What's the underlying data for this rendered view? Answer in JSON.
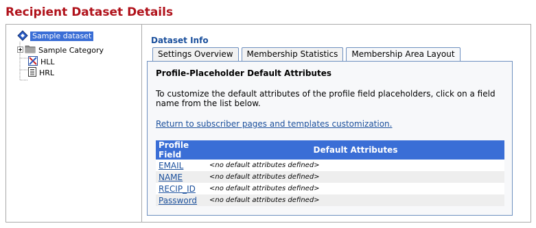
{
  "page": {
    "title": "Recipient Dataset Details"
  },
  "tree": {
    "root": {
      "label": "Sample dataset",
      "icon": "dataset-icon",
      "selected": true
    },
    "items": [
      {
        "label": "Sample Category",
        "icon": "folder-icon",
        "expander": "+"
      },
      {
        "label": "HLL",
        "icon": "hll-icon"
      },
      {
        "label": "HRL",
        "icon": "hrl-icon"
      }
    ]
  },
  "section": {
    "title": "Dataset Info"
  },
  "tabs": [
    {
      "label": "Settings Overview",
      "active": false
    },
    {
      "label": "Membership Statistics",
      "active": false
    },
    {
      "label": "Membership Area Layout",
      "active": true
    }
  ],
  "panel": {
    "heading": "Profile-Placeholder Default Attributes",
    "instructions": "To customize the default attributes of the profile field placeholders, click on a field name from the list below.",
    "return_link": "Return to subscriber pages and templates customization."
  },
  "table": {
    "headers": [
      "Profile Field",
      "Default Attributes"
    ],
    "rows": [
      {
        "field": "EMAIL",
        "attributes": "<no default attributes defined>"
      },
      {
        "field": "NAME",
        "attributes": "<no default attributes defined>"
      },
      {
        "field": "RECIP_ID",
        "attributes": "<no default attributes defined>"
      },
      {
        "field": "Password",
        "attributes": "<no default attributes defined>"
      }
    ]
  },
  "colors": {
    "title_red": "#b0121b",
    "header_blue": "#3a6ed6",
    "link_blue": "#1a4f9c",
    "tab_border": "#6d8fbf"
  }
}
